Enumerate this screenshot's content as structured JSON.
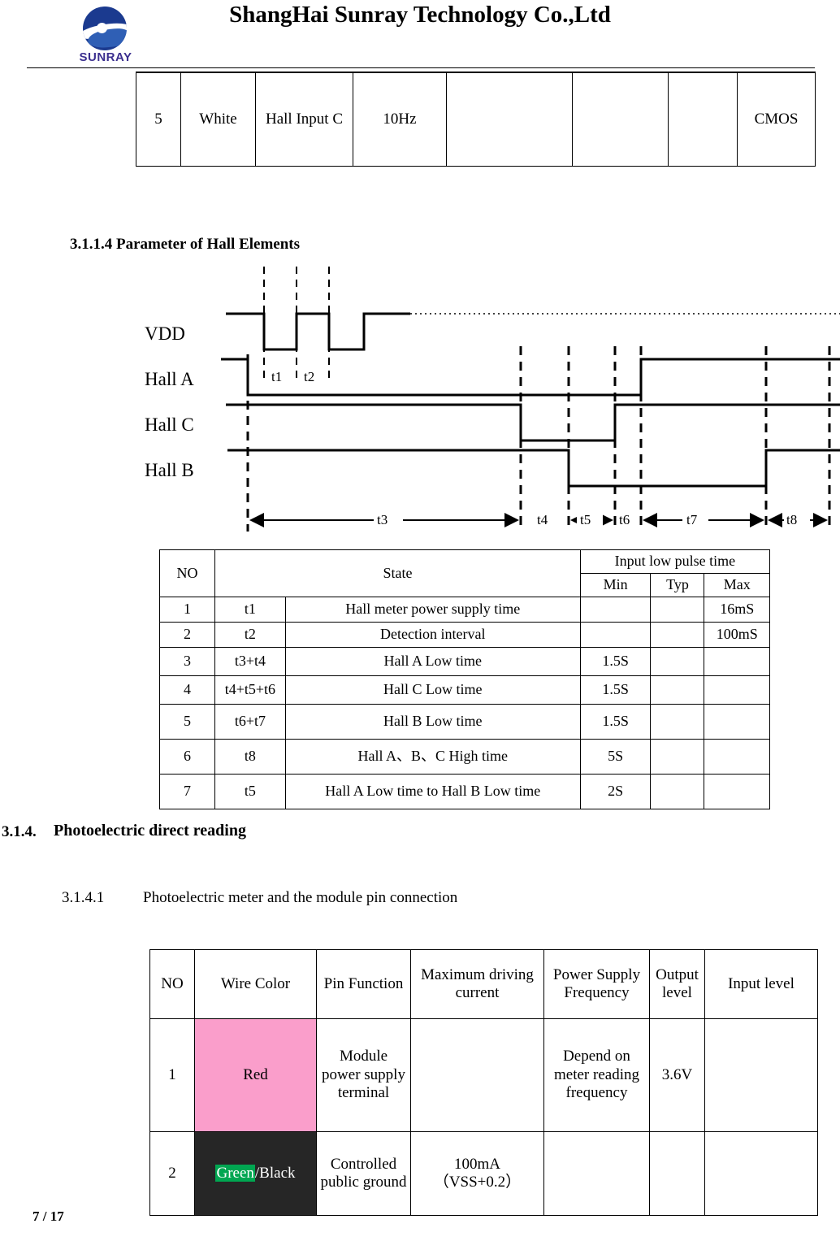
{
  "header": {
    "company_title": "ShangHai Sunray Technology Co.,Ltd",
    "logo_text": "SUNRAY",
    "logo_icon": "sunray-wave-logo"
  },
  "hall_wire_table": {
    "name": "hall-wire-continuation-table",
    "rows": [
      {
        "no": "5",
        "wire_color": "White",
        "pin_function": "Hall Input C",
        "frequency": "10Hz",
        "col5": "",
        "col6": "",
        "col7": "",
        "level": "CMOS"
      }
    ]
  },
  "sections": {
    "heading_3114": "3.1.1.4 Parameter of Hall Elements",
    "heading_314_number": "3.1.4.",
    "heading_314_text": "Photoelectric direct reading",
    "heading_3141_number": "3.1.4.1",
    "heading_3141_text": "Photoelectric meter and the module pin connection"
  },
  "timing_diagram": {
    "name": "hall-elements-timing-diagram",
    "signals": [
      "VDD",
      "Hall A",
      "Hall C",
      "Hall B"
    ],
    "interval_labels": [
      "t1",
      "t2"
    ],
    "span_labels": [
      "t3",
      "t4",
      "t5",
      "t6",
      "t7",
      "t8"
    ]
  },
  "hall_param_table": {
    "headers": {
      "no": "NO",
      "state": "State",
      "group": "Input low pulse time",
      "min": "Min",
      "typ": "Typ",
      "max": "Max"
    },
    "rows": [
      {
        "no": "1",
        "symbol": "t1",
        "state": "Hall meter power supply time",
        "min": "",
        "typ": "",
        "max": "16mS"
      },
      {
        "no": "2",
        "symbol": "t2",
        "state": "Detection interval",
        "min": "",
        "typ": "",
        "max": "100mS"
      },
      {
        "no": "3",
        "symbol": "t3+t4",
        "state": "Hall A Low time",
        "min": "1.5S",
        "typ": "",
        "max": ""
      },
      {
        "no": "4",
        "symbol": "t4+t5+t6",
        "state": "Hall C Low time",
        "min": "1.5S",
        "typ": "",
        "max": ""
      },
      {
        "no": "5",
        "symbol": "t6+t7",
        "state": "Hall B Low time",
        "min": "1.5S",
        "typ": "",
        "max": ""
      },
      {
        "no": "6",
        "symbol": "t8",
        "state": "Hall A、B、C High time",
        "min": "5S",
        "typ": "",
        "max": ""
      },
      {
        "no": "7",
        "symbol": "t5",
        "state": "Hall A Low time to Hall B Low time",
        "min": "2S",
        "typ": "",
        "max": ""
      }
    ]
  },
  "pin_conn_table": {
    "headers": {
      "no": "NO",
      "wire_color": "Wire Color",
      "pin_function": "Pin Function",
      "max_current": "Maximum driving current",
      "power_freq": "Power Supply Frequency",
      "output_level": "Output level",
      "input_level": "Input level"
    },
    "rows": [
      {
        "no": "1",
        "wire_color": "Red",
        "wire_color_swatch": "#FA9ECB",
        "pin_function": "Module power supply terminal",
        "max_current": "",
        "power_freq": "Depend on meter reading frequency",
        "output_level": "3.6V",
        "input_level": ""
      },
      {
        "no": "2",
        "wire_color_part1": "Green",
        "wire_color_part2": "/Black",
        "wire_color_swatch": "#262626",
        "highlight_color": "#00A651",
        "pin_function": "Controlled public ground",
        "max_current_line1": "100mA",
        "max_current_line2": "（VSS+0.2）",
        "power_freq": "",
        "output_level": "",
        "input_level": ""
      }
    ]
  },
  "footer": {
    "page": "7 / 17"
  }
}
